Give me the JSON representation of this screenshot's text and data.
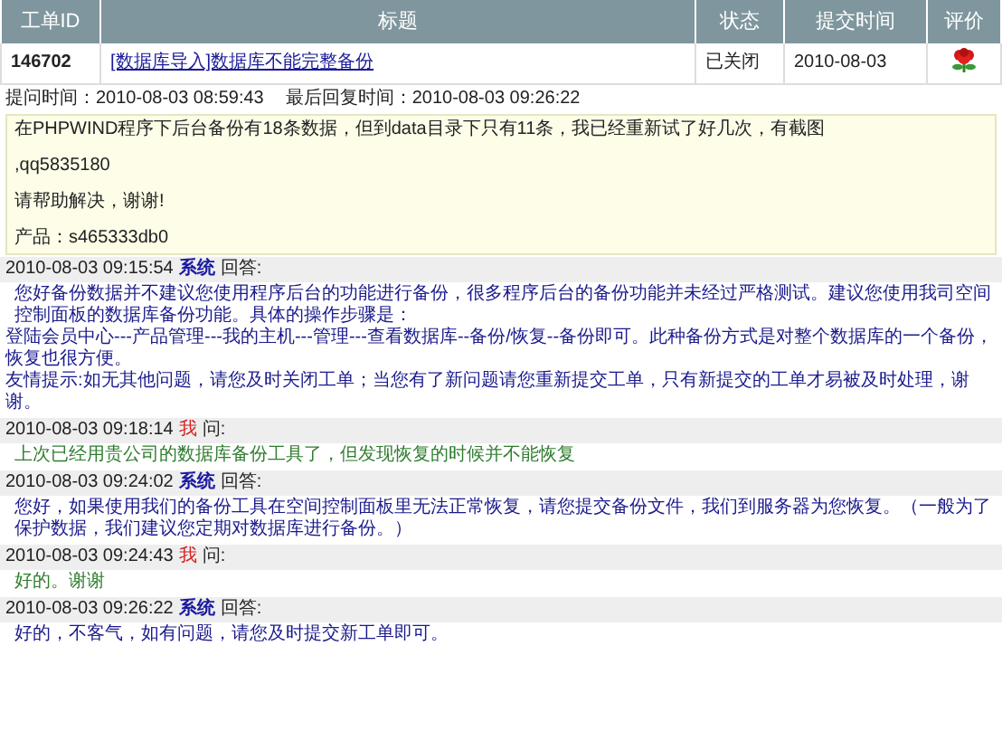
{
  "table": {
    "columns": [
      "工单ID",
      "标题",
      "状态",
      "提交时间",
      "评价"
    ],
    "rows": [
      {
        "id": "146702",
        "title": "[数据库导入]数据库不能完整备份",
        "status": "已关闭",
        "date": "2010-08-03"
      }
    ]
  },
  "meta": {
    "asked_label": "提问时间：",
    "asked": "2010-08-03 08:59:43",
    "last_label": "最后回复时间：",
    "last": "2010-08-03 09:26:22"
  },
  "question": [
    "在PHPWIND程序下后台备份有18条数据，但到data目录下只有11条，我已经重新试了好几次，有截图",
    ",qq5835180",
    "请帮助解决，谢谢!",
    "产品：s465333db0"
  ],
  "replies": [
    {
      "kind": "system",
      "time": "2010-08-03 09:15:54",
      "who": "系统",
      "verb": "回答:",
      "body": [
        "您好备份数据并不建议您使用程序后台的功能进行备份，很多程序后台的备份功能并未经过严格测试。建议您使用我司空间控制面板的数据库备份功能。具体的操作步骤是：",
        "登陆会员中心---产品管理---我的主机---管理---查看数据库--备份/恢复--备份即可。此种备份方式是对整个数据库的一个备份，恢复也很方便。"
      ],
      "tip": "友情提示:如无其他问题，请您及时关闭工单；当您有了新问题请您重新提交工单，只有新提交的工单才易被及时处理，谢谢。"
    },
    {
      "kind": "user",
      "time": "2010-08-03 09:18:14",
      "who": "我",
      "verb": "问:",
      "body": [
        "上次已经用贵公司的数据库备份工具了，但发现恢复的时候并不能恢复"
      ]
    },
    {
      "kind": "system",
      "time": "2010-08-03 09:24:02",
      "who": "系统",
      "verb": "回答:",
      "body": [
        "您好，如果使用我们的备份工具在空间控制面板里无法正常恢复，请您提交备份文件，我们到服务器为您恢复。（一般为了保护数据，我们建议您定期对数据库进行备份。）"
      ]
    },
    {
      "kind": "user",
      "time": "2010-08-03 09:24:43",
      "who": "我",
      "verb": "问:",
      "body": [
        "好的。谢谢"
      ]
    },
    {
      "kind": "system",
      "time": "2010-08-03 09:26:22",
      "who": "系统",
      "verb": "回答:",
      "body": [
        "好的，不客气，如有问题，请您及时提交新工单即可。"
      ]
    }
  ]
}
